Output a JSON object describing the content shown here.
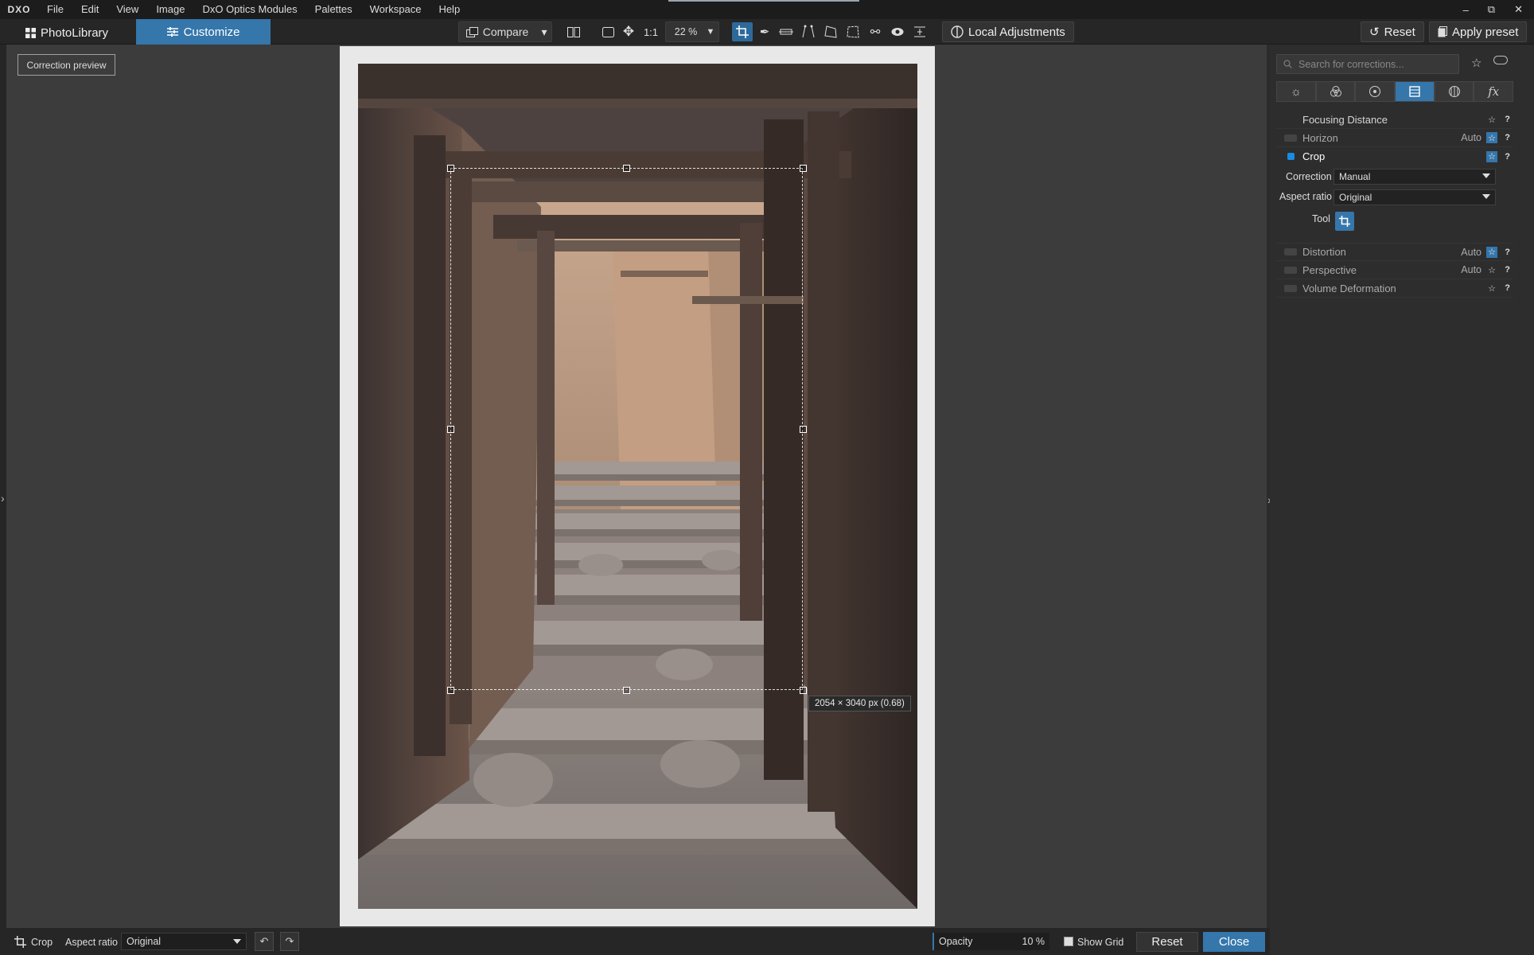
{
  "menubar": {
    "logo": "DXO",
    "items": [
      "File",
      "Edit",
      "View",
      "Image",
      "DxO Optics Modules",
      "Palettes",
      "Workspace",
      "Help"
    ]
  },
  "toolbar": {
    "tab_library": "PhotoLibrary",
    "tab_customize": "Customize",
    "compare_label": "Compare",
    "one_to_one": "1:1",
    "zoom": "22 %",
    "local_adjustments": "Local Adjustments",
    "reset": "Reset",
    "apply_preset": "Apply preset"
  },
  "viewer": {
    "correction_preview": "Correction preview",
    "crop_dimensions": "2054 × 3040 px (0.68)"
  },
  "panel": {
    "search_placeholder": "Search for corrections...",
    "tabs": [
      "light-icon",
      "color-icon",
      "detail-icon",
      "geometry-icon",
      "watermark-icon",
      "fx-icon"
    ],
    "focusing_distance": "Focusing Distance",
    "horizon": {
      "label": "Horizon",
      "mode": "Auto"
    },
    "crop": {
      "label": "Crop"
    },
    "correction_label": "Correction",
    "correction_value": "Manual",
    "aspect_label": "Aspect ratio",
    "aspect_value": "Original",
    "tool_label": "Tool",
    "distortion": {
      "label": "Distortion",
      "mode": "Auto"
    },
    "perspective": {
      "label": "Perspective",
      "mode": "Auto"
    },
    "volume": {
      "label": "Volume Deformation"
    },
    "help": "?"
  },
  "bottombar": {
    "crop_label": "Crop",
    "aspect_label": "Aspect ratio",
    "aspect_value": "Original",
    "opacity_label": "Opacity",
    "opacity_value": "10 %",
    "show_grid": "Show Grid",
    "reset": "Reset",
    "close": "Close"
  },
  "colors": {
    "accent": "#3576ab",
    "checkbox_on": "#1a8be0"
  }
}
